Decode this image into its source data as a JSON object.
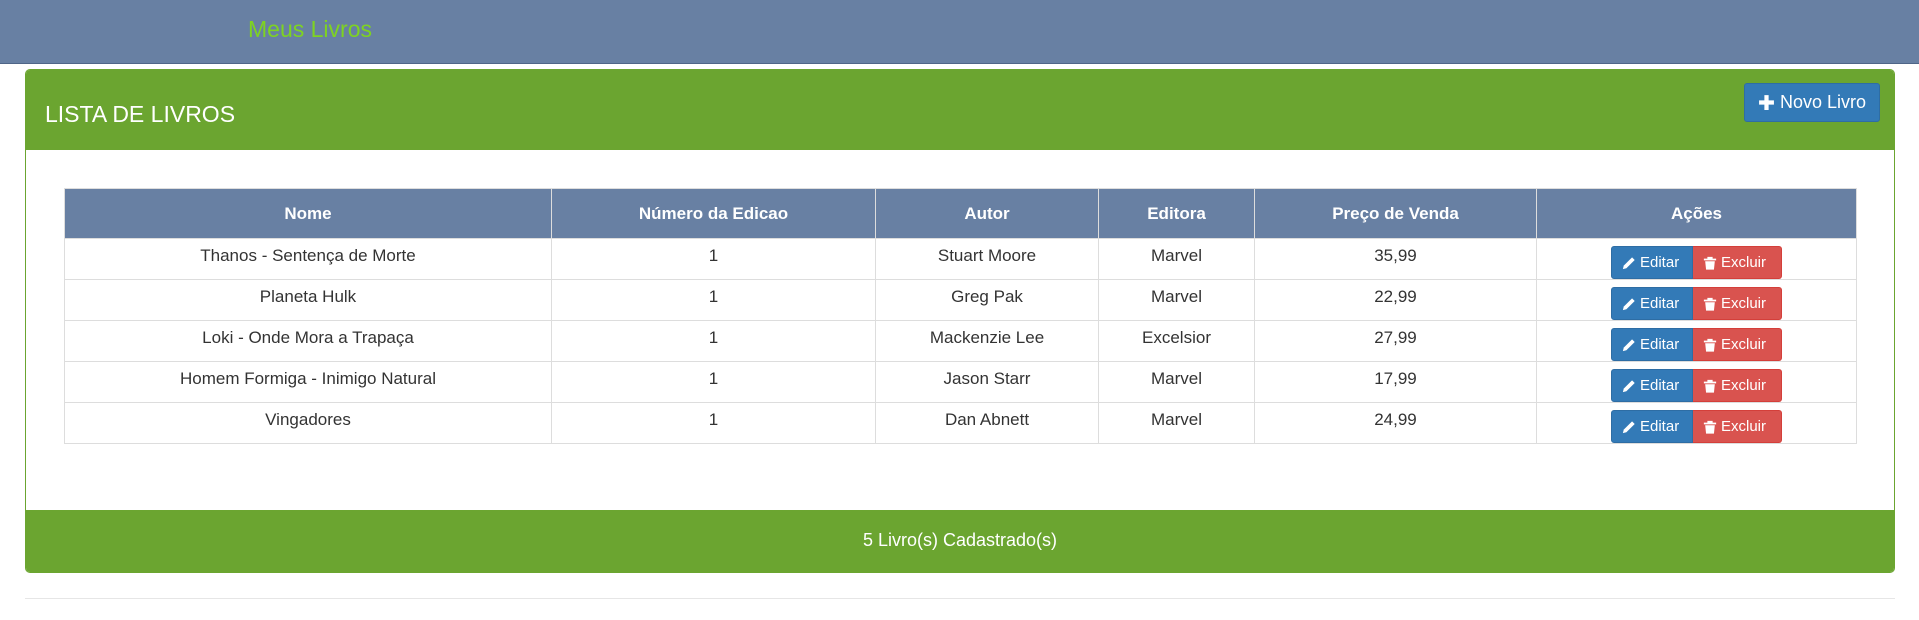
{
  "navbar": {
    "brand": "Meus Livros"
  },
  "panel": {
    "title": "LISTA DE LIVROS",
    "new_button_label": "Novo Livro",
    "footer_text": "5 Livro(s) Cadastrado(s)"
  },
  "table": {
    "headers": [
      "Nome",
      "Número da Edicao",
      "Autor",
      "Editora",
      "Preço de Venda",
      "Ações"
    ],
    "rows": [
      {
        "nome": "Thanos - Sentença de Morte",
        "edicao": "1",
        "autor": "Stuart Moore",
        "editora": "Marvel",
        "preco": "35,99"
      },
      {
        "nome": "Planeta Hulk",
        "edicao": "1",
        "autor": "Greg Pak",
        "editora": "Marvel",
        "preco": "22,99"
      },
      {
        "nome": "Loki - Onde Mora a Trapaça",
        "edicao": "1",
        "autor": "Mackenzie Lee",
        "editora": "Excelsior",
        "preco": "27,99"
      },
      {
        "nome": "Homem Formiga - Inimigo Natural",
        "edicao": "1",
        "autor": "Jason Starr",
        "editora": "Marvel",
        "preco": "17,99"
      },
      {
        "nome": "Vingadores",
        "edicao": "1",
        "autor": "Dan Abnett",
        "editora": "Marvel",
        "preco": "24,99"
      }
    ],
    "edit_label": "Editar",
    "delete_label": "Excluir"
  },
  "icons": {
    "new": "plus-icon",
    "edit": "pencil-icon",
    "delete": "trash-icon"
  },
  "colors": {
    "navbar": "#6880a3",
    "brand_text": "#7ed321",
    "panel_accent": "#6ba530",
    "table_header": "#6880a3",
    "primary_button": "#337ab7",
    "danger_button": "#d9534f"
  }
}
